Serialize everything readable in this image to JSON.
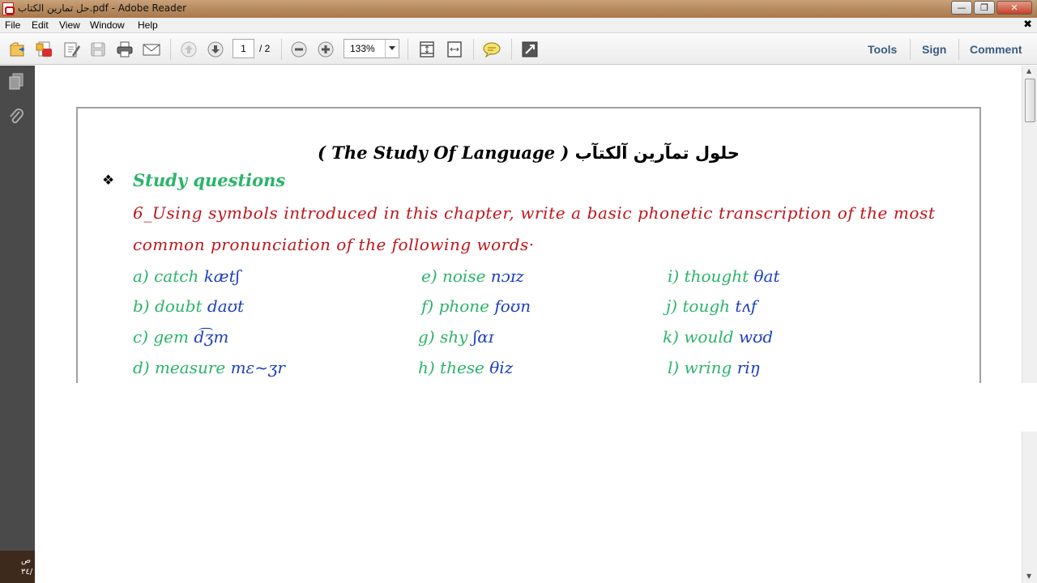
{
  "window": {
    "title": "حل تمارين الكتاب.pdf - Adobe Reader"
  },
  "menu": [
    "File",
    "Edit",
    "View",
    "Window",
    "Help"
  ],
  "toolbar": {
    "page_current": "1",
    "page_total": "/ 2",
    "zoom": "133%",
    "right_links": [
      "Tools",
      "Sign",
      "Comment"
    ],
    "icons": [
      "open-icon",
      "create-pdf-icon",
      "edit-icon",
      "save-icon",
      "print-icon",
      "email-icon",
      "page-up-icon",
      "page-down-icon",
      "zoom-out-icon",
      "zoom-in-icon",
      "fit-page-icon",
      "fit-width-icon",
      "comment-icon",
      "fullscreen-icon"
    ]
  },
  "document": {
    "heading_ar": "حلول تمآرين آلكتآب",
    "heading_en": "( The Study Of Language )",
    "section": "Study questions",
    "question_line1": "6_Using symbols introduced in this chapter, write a basic phonetic transcription of the most",
    "question_line2": "common pronunciation of the following words·",
    "answers": [
      {
        "label": "a) catch",
        "ipa": "kætʃ"
      },
      {
        "label": "b) doubt",
        "ipa": "daʊt"
      },
      {
        "label": "c) gem",
        "ipa": "d͡ʒm"
      },
      {
        "label": "d) measure",
        "ipa": "mɛ~ʒr"
      },
      {
        "label": "e) noise",
        "ipa": "nɔɪz"
      },
      {
        "label": "f) phone",
        "ipa": "foʊn"
      },
      {
        "label": "g) shy",
        "ipa": "ʃɑɪ"
      },
      {
        "label": "h) these",
        "ipa": "θiz"
      },
      {
        "label": "i) thought",
        "ipa": "θat"
      },
      {
        "label": "j) tough",
        "ipa": "tʌf"
      },
      {
        "label": "k) would",
        "ipa": "wʊd"
      },
      {
        "label": "l) wring",
        "ipa": "riŋ"
      }
    ]
  },
  "statusbar": {
    "line1": "ص",
    "line2": "٣٤/"
  }
}
